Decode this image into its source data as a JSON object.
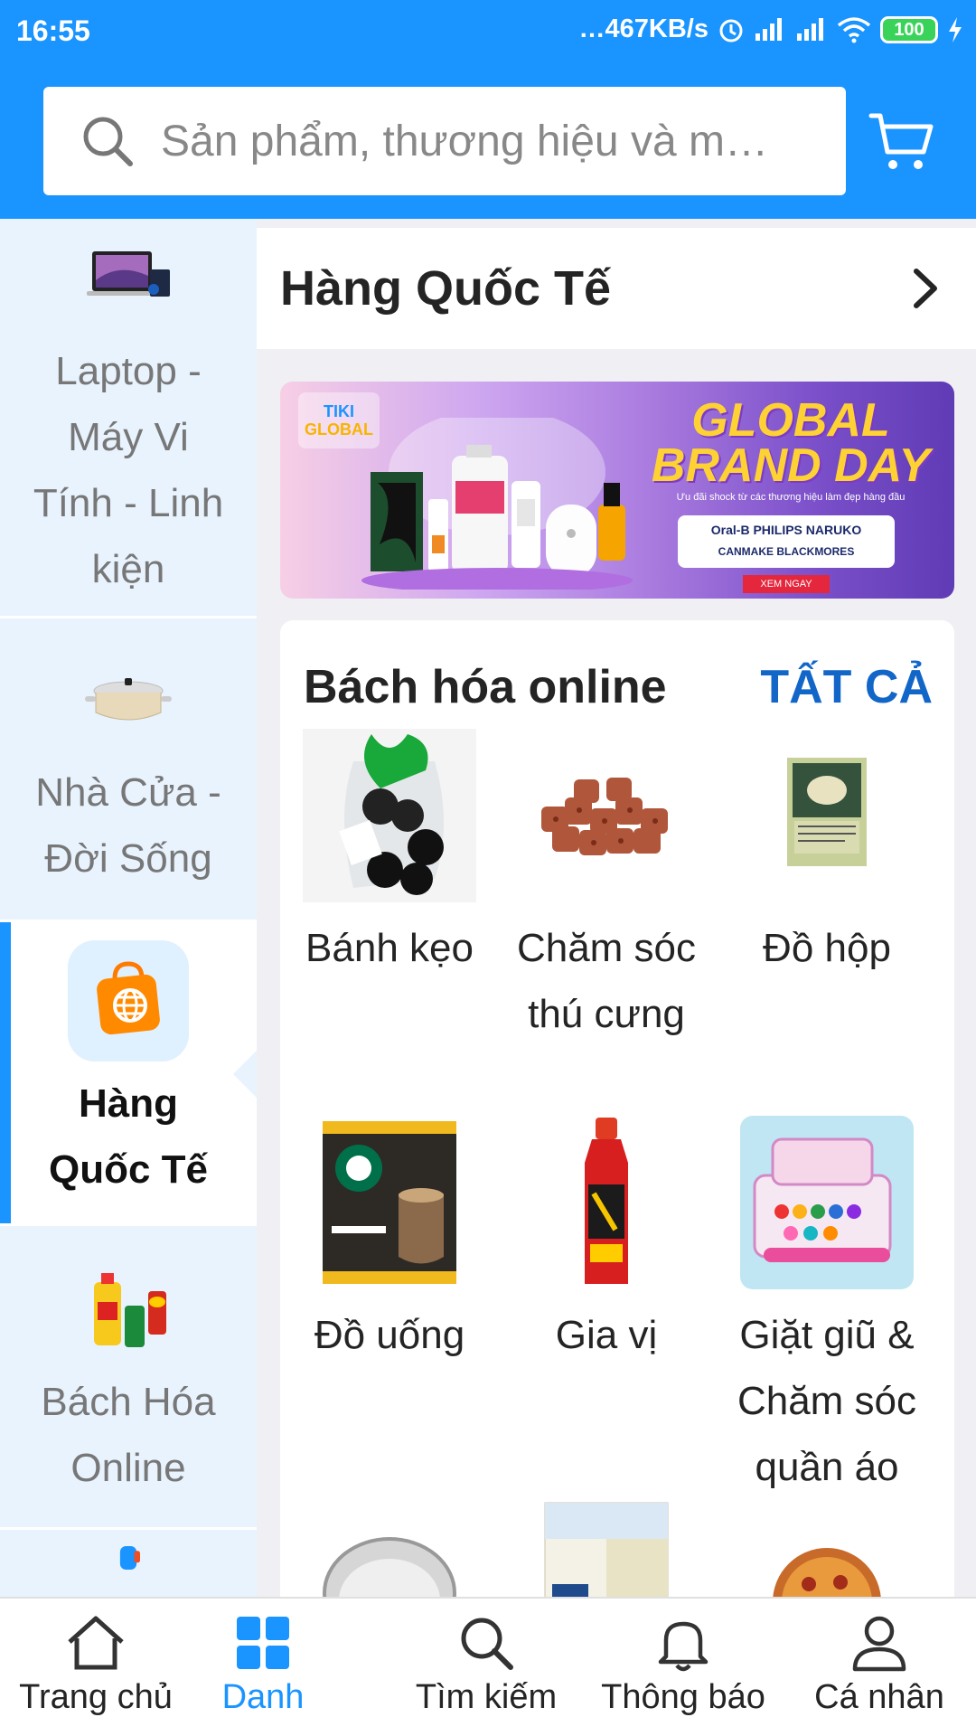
{
  "status": {
    "time": "16:55",
    "network_speed": "…467KB/s",
    "battery": "100"
  },
  "search": {
    "placeholder": "Sản phẩm, thương hiệu và m…"
  },
  "sidebar": {
    "items": [
      {
        "label": "Laptop - Máy Vi Tính - Linh kiện",
        "icon": "laptop-icon"
      },
      {
        "label": "Nhà Cửa - Đời Sống",
        "icon": "cookware-icon"
      },
      {
        "label": "Hàng Quốc Tế",
        "icon": "global-shopping-bag-icon",
        "active": true
      },
      {
        "label": "Bách Hóa Online",
        "icon": "grocery-icon"
      }
    ]
  },
  "main": {
    "title": "Hàng Quốc Tế",
    "banner": {
      "logo_line1": "TIKI",
      "logo_line2": "GLOBAL",
      "headline": "GLOBAL BRAND DAY",
      "subtitle": "Ưu đãi shock từ các thương hiệu làm đẹp hàng đầu",
      "brands_line1": "Oral-B PHILIPS NARUKO",
      "brands_line2": "CANMAKE BLACKMORES",
      "button": "XEM NGAY"
    },
    "section": {
      "title": "Bách hóa online",
      "see_all": "TẤT CẢ",
      "items": [
        {
          "label": "Bánh kẹo"
        },
        {
          "label": "Chăm sóc thú cưng"
        },
        {
          "label": "Đồ hộp"
        },
        {
          "label": "Đồ uống"
        },
        {
          "label": "Gia vị"
        },
        {
          "label": "Giặt giũ & Chăm sóc quần áo"
        }
      ]
    }
  },
  "bottom_nav": [
    {
      "label": "Trang chủ",
      "icon": "home-icon"
    },
    {
      "label": "Danh",
      "icon": "category-grid-icon",
      "active": true
    },
    {
      "label": "Tìm kiếm",
      "icon": "search-icon"
    },
    {
      "label": "Thông báo",
      "icon": "bell-icon"
    },
    {
      "label": "Cá nhân",
      "icon": "person-icon"
    }
  ],
  "colors": {
    "primary": "#1a94ff",
    "sidebar_bg": "#e8f3fe",
    "see_all": "#1266c8"
  }
}
